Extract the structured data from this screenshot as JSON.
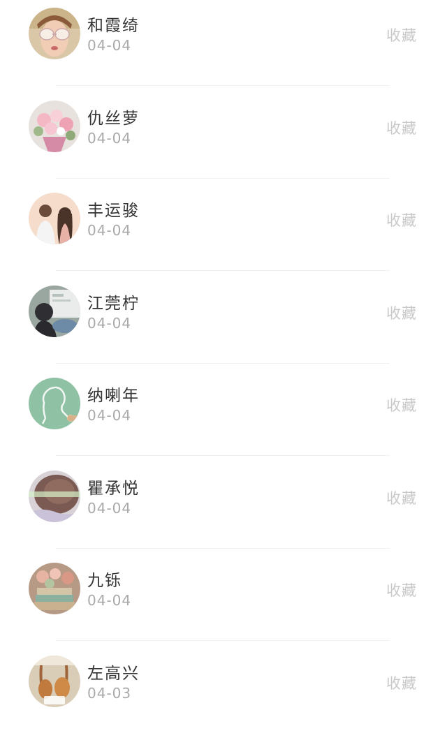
{
  "items": [
    {
      "name": "和霞绮",
      "date": "04-04",
      "action": "收藏",
      "avatar_icon": "avatar-woman-sunglasses"
    },
    {
      "name": "仇丝萝",
      "date": "04-04",
      "action": "收藏",
      "avatar_icon": "avatar-flower-bouquet"
    },
    {
      "name": "丰运骏",
      "date": "04-04",
      "action": "收藏",
      "avatar_icon": "avatar-couple-drawing"
    },
    {
      "name": "江莞柠",
      "date": "04-04",
      "action": "收藏",
      "avatar_icon": "avatar-girl-classroom"
    },
    {
      "name": "纳喇年",
      "date": "04-04",
      "action": "收藏",
      "avatar_icon": "avatar-chalk-outline"
    },
    {
      "name": "瞿承悦",
      "date": "04-04",
      "action": "收藏",
      "avatar_icon": "avatar-hair-closeup"
    },
    {
      "name": "九铄",
      "date": "04-04",
      "action": "收藏",
      "avatar_icon": "avatar-flower-cake"
    },
    {
      "name": "左高兴",
      "date": "04-03",
      "action": "收藏",
      "avatar_icon": "avatar-roast-chicken"
    }
  ],
  "colors": {
    "name_text": "#333333",
    "date_text": "#a9a9a9",
    "action_text": "#c9c9c9",
    "divider": "#f1f1f1",
    "background": "#ffffff"
  }
}
